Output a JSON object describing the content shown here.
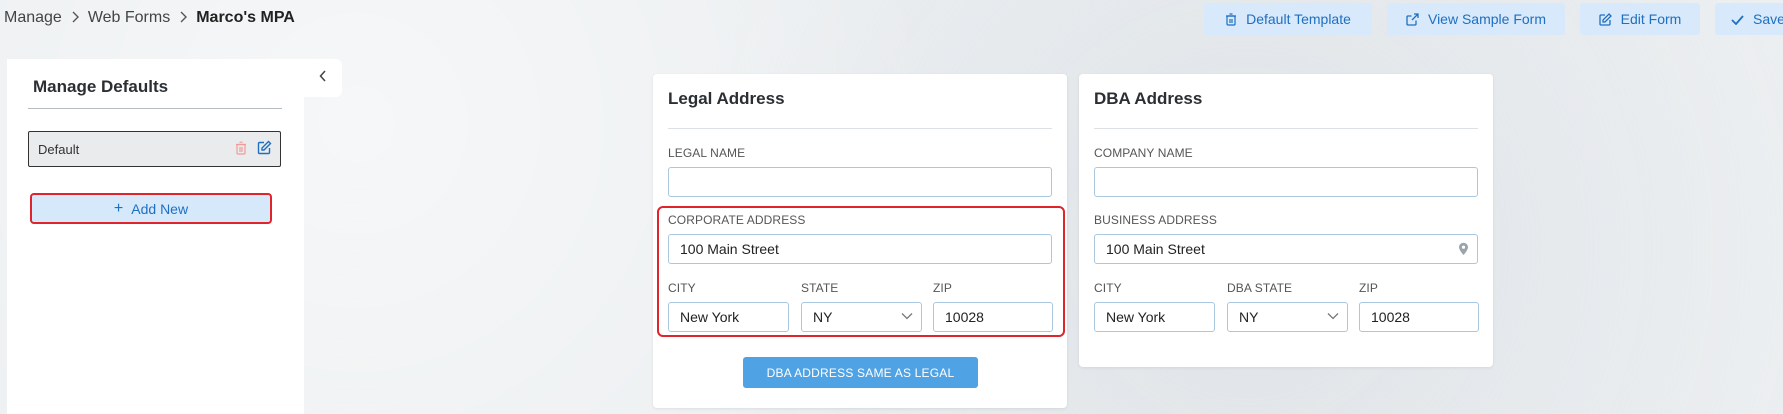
{
  "breadcrumb": {
    "items": [
      "Manage",
      "Web Forms"
    ],
    "current": "Marco's MPA"
  },
  "toolbar": {
    "default_template": "Default Template",
    "view_sample_form": "View Sample Form",
    "edit_form": "Edit Form",
    "save": "Save"
  },
  "sidebar": {
    "title": "Manage Defaults",
    "items": [
      {
        "label": "Default"
      }
    ],
    "add_new": "Add New"
  },
  "legal": {
    "title": "Legal Address",
    "legal_name_label": "LEGAL NAME",
    "legal_name_value": "",
    "corporate_address_label": "CORPORATE ADDRESS",
    "corporate_address_value": "100 Main Street",
    "city_label": "CITY",
    "city_value": "New York",
    "state_label": "STATE",
    "state_value": "NY",
    "zip_label": "ZIP",
    "zip_value": "10028",
    "same_button": "DBA ADDRESS SAME AS LEGAL"
  },
  "dba": {
    "title": "DBA Address",
    "company_name_label": "COMPANY NAME",
    "company_name_value": "",
    "business_address_label": "BUSINESS ADDRESS",
    "business_address_value": "100 Main Street",
    "city_label": "CITY",
    "city_value": "New York",
    "state_label": "DBA STATE",
    "state_value": "NY",
    "zip_label": "ZIP",
    "zip_value": "10028"
  },
  "colors": {
    "accent": "#1f6fc2",
    "button_bg": "#d7e9fa",
    "primary_button": "#4fa2e3",
    "highlight": "#e0242c"
  }
}
